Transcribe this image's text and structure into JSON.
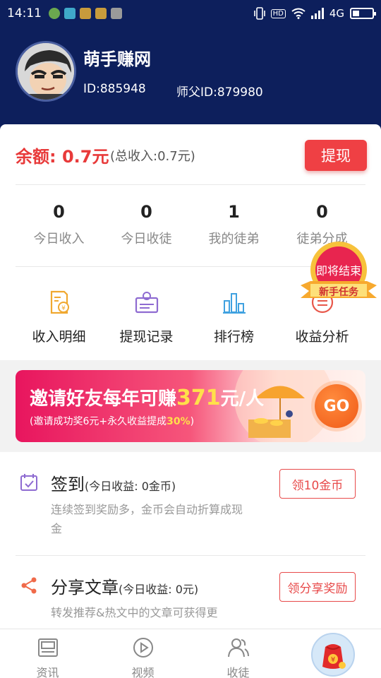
{
  "status_bar": {
    "time": "14:11",
    "network": "4G",
    "hd": "HD"
  },
  "profile": {
    "name": "萌手赚网",
    "id": "ID:885948",
    "master_id": "师父ID:879980"
  },
  "balance": {
    "label": "余额: 0.7元",
    "total": "(总收入:0.7元)",
    "withdraw_label": "提现"
  },
  "stats": [
    {
      "value": "0",
      "label": "今日收入"
    },
    {
      "value": "0",
      "label": "今日收徒"
    },
    {
      "value": "1",
      "label": "我的徒弟"
    },
    {
      "value": "0",
      "label": "徒弟分成"
    }
  ],
  "tools": [
    {
      "label": "收入明细",
      "icon": "income-detail-icon"
    },
    {
      "label": "提现记录",
      "icon": "withdraw-record-icon"
    },
    {
      "label": "排行榜",
      "icon": "leaderboard-icon"
    },
    {
      "label": "收益分析",
      "icon": "analysis-icon"
    }
  ],
  "badge": {
    "top": "即将结束",
    "ribbon": "新手任务"
  },
  "banner": {
    "title_prefix": "邀请好友每年可赚",
    "title_amount": "371",
    "title_suffix": "元/人",
    "sub_prefix": "(邀请成功奖6元+永久收益提成",
    "sub_highlight": "30%",
    "sub_suffix": ")",
    "go_label": "GO"
  },
  "tasks": [
    {
      "title": "签到",
      "note": "(今日收益: 0金币)",
      "desc": "连续签到奖励多，金币会自动折算成现金",
      "button": "领10金币",
      "icon": "calendar-check-icon"
    },
    {
      "title": "分享文章",
      "note": "(今日收益: 0元)",
      "desc": "转发推荐&热文中的文章可获得更",
      "button": "领分享奖励",
      "icon": "share-icon"
    }
  ],
  "bottom_nav": [
    {
      "label": "资讯",
      "icon": "news-icon"
    },
    {
      "label": "视频",
      "icon": "video-play-icon"
    },
    {
      "label": "收徒",
      "icon": "users-icon"
    },
    {
      "label": "",
      "icon": "red-envelope-icon"
    }
  ],
  "colors": {
    "header_bg": "#0d1f5c",
    "accent_red": "#ef4044",
    "banner_pink": "#e8155e",
    "highlight_yellow": "#ffe04a"
  }
}
